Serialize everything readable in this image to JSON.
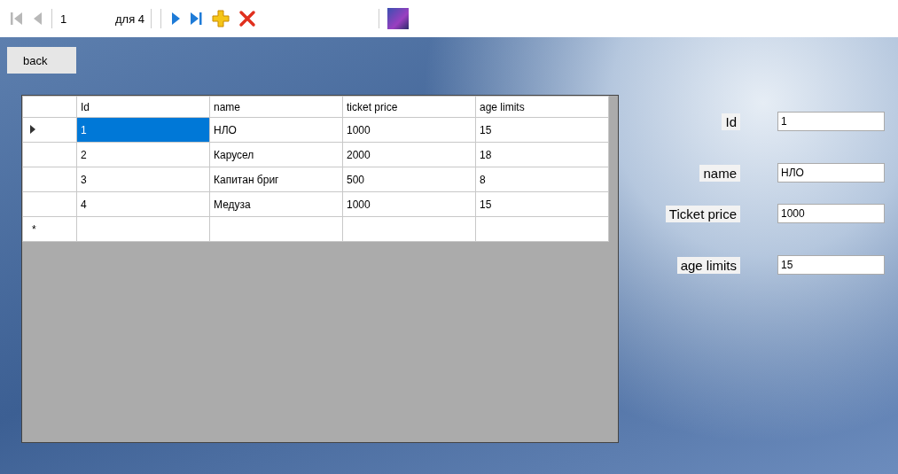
{
  "toolbar": {
    "items": [
      {
        "kind": "first",
        "disabled": true
      },
      {
        "kind": "prev",
        "disabled": true
      },
      {
        "kind": "position",
        "value": "1"
      },
      {
        "kind": "count",
        "text": "для 4"
      },
      {
        "kind": "next",
        "disabled": false
      },
      {
        "kind": "last",
        "disabled": false
      },
      {
        "kind": "add",
        "disabled": false
      },
      {
        "kind": "delete",
        "disabled": false
      },
      {
        "kind": "image"
      }
    ]
  },
  "back_button": {
    "label": "back"
  },
  "table": {
    "columns": [
      "Id",
      "name",
      "ticket price",
      "age limits"
    ],
    "rows": [
      {
        "selected": true,
        "cells": [
          "1",
          "НЛО",
          "1000",
          "15"
        ]
      },
      {
        "selected": false,
        "cells": [
          "2",
          "Карусел",
          "2000",
          "18"
        ]
      },
      {
        "selected": false,
        "cells": [
          "3",
          "Капитан бриг",
          "500",
          "8"
        ]
      },
      {
        "selected": false,
        "cells": [
          "4",
          "Медуза",
          "1000",
          "15"
        ]
      }
    ],
    "new_row_marker": "*"
  },
  "details": [
    {
      "label": "Id",
      "value": "1"
    },
    {
      "label": "name",
      "value": "НЛО"
    },
    {
      "label": "Ticket price",
      "value": "1000"
    },
    {
      "label": "age limits",
      "value": "15"
    }
  ]
}
